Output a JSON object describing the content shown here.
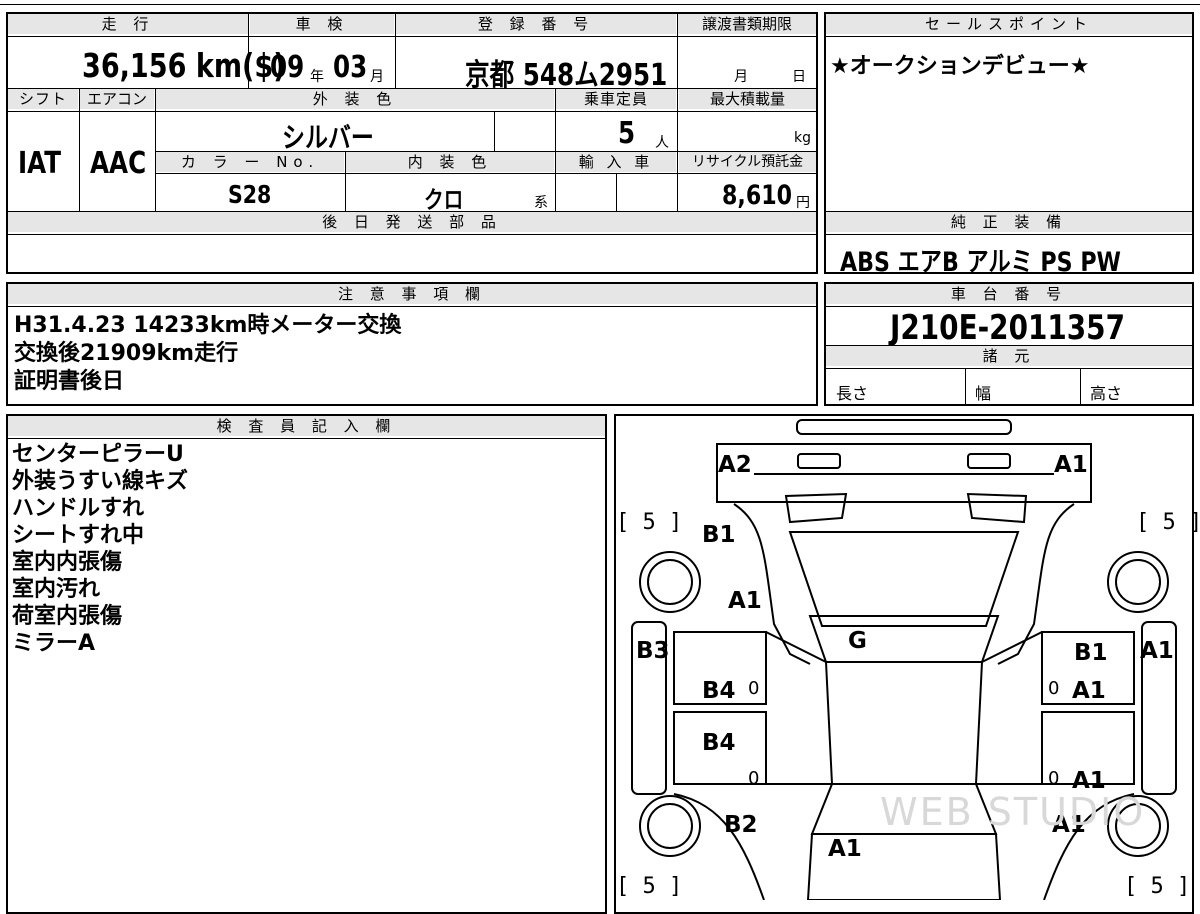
{
  "top": {
    "mileage_label": "走 行",
    "mileage_value": "36,156 km($)",
    "inspection_label": "車 検",
    "inspection_year": "09",
    "inspection_year_unit": "年",
    "inspection_month": "03",
    "inspection_month_unit": "月",
    "registration_label": "登 録 番 号",
    "registration_value": "京都 548ム2951",
    "transfer_label": "譲渡書類期限",
    "transfer_month_unit": "月",
    "transfer_day_unit": "日",
    "shift_label": "シフト",
    "shift_value": "IAT",
    "aircon_label": "エアコン",
    "aircon_value": "AAC",
    "exterior_color_label": "外 装 色",
    "exterior_color_value": "シルバー",
    "capacity_label": "乗車定員",
    "capacity_value": "5",
    "capacity_unit": "人",
    "max_load_label": "最大積載量",
    "max_load_unit": "kg",
    "color_no_label": "カ ラ ー No.",
    "color_no_value": "S28",
    "interior_color_label": "内 装 色",
    "interior_color_value": "クロ",
    "interior_color_suffix": "系",
    "import_label": "輸 入 車",
    "recycle_label": "リサイクル預託金",
    "recycle_value": "8,610",
    "recycle_unit": "円",
    "later_parts_label": "後 日 発 送 部 品"
  },
  "sales": {
    "label": "セールスポイント",
    "text": "★オークションデビュー★"
  },
  "equipment": {
    "label": "純 正 装 備",
    "items": "ABS エアB アルミ PS PW"
  },
  "notes": {
    "label": "注 意 事 項 欄",
    "lines": [
      "H31.4.23  14233km時メーター交換",
      "交換後21909km走行",
      "証明書後日"
    ]
  },
  "chassis": {
    "label": "車 台 番 号",
    "value": "J210E-2011357",
    "specs_label": "諸 元",
    "length_label": "長さ",
    "width_label": "幅",
    "height_label": "高さ"
  },
  "inspector": {
    "label": "検 査 員 記 入 欄",
    "lines": [
      "センターピラーU",
      "外装うすい線キズ",
      "ハンドルすれ",
      "シートすれ中",
      "室内内張傷",
      "室内汚れ",
      "荷室内張傷",
      "ミラーA"
    ]
  },
  "diagram": {
    "codes": {
      "front_left": "A2",
      "front_right": "A1",
      "left_fender": "B1",
      "left_fender_low": "A1",
      "roof": "G",
      "left_sill": "B3",
      "left_front_door": "B4",
      "left_rear_door": "B4",
      "right_front_door_upper": "B1",
      "right_front_door": "A1",
      "right_sill": "A1",
      "right_rear_door": "A1",
      "left_rear_fender": "B2",
      "right_rear_fender": "A1",
      "rear": "A1"
    },
    "tire_marks": {
      "front_left": "[ 5 ]",
      "front_right": "[ 5 ]",
      "rear_left": "[ 5 ]",
      "rear_right": "[ 5 ]"
    },
    "zero_marks": [
      "0",
      "0",
      "0",
      "0"
    ],
    "watermark": "WEB STUDIO"
  }
}
